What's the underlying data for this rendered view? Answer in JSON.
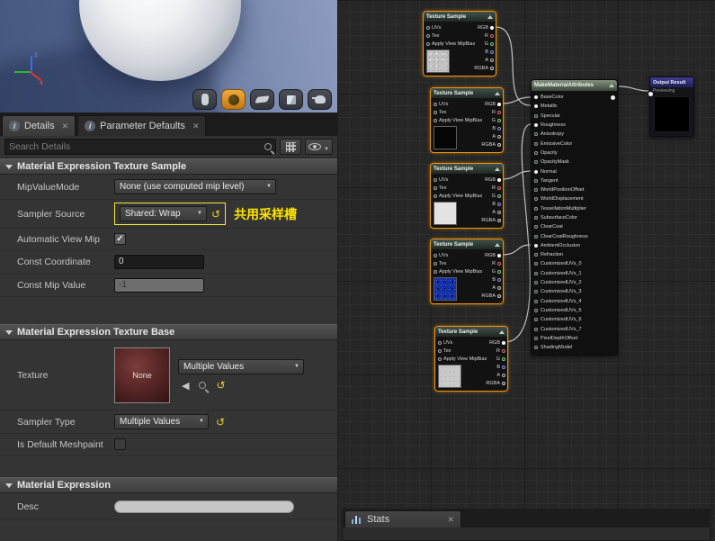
{
  "viewport": {
    "toolbar": [
      {
        "name": "preview-shape-cylinder",
        "selected": false
      },
      {
        "name": "preview-shape-sphere",
        "selected": true
      },
      {
        "name": "preview-shape-plane",
        "selected": false
      },
      {
        "name": "preview-shape-cube",
        "selected": false
      },
      {
        "name": "preview-shape-custom",
        "selected": false
      }
    ],
    "axis_labels": {
      "z": "z",
      "x": "x"
    }
  },
  "tabs": {
    "details": "Details",
    "parameter_defaults": "Parameter Defaults"
  },
  "search": {
    "placeholder": "Search Details"
  },
  "sections": {
    "texture_sample": {
      "title": "Material Expression Texture Sample",
      "mip_value_mode_label": "MipValueMode",
      "mip_value_mode_value": "None (use computed mip level)",
      "sampler_source_label": "Sampler Source",
      "sampler_source_value": "Shared: Wrap",
      "sampler_source_annotation": "共用采样槽",
      "automatic_view_mip_label": "Automatic View Mip",
      "automatic_view_mip_checked": true,
      "const_coordinate_label": "Const Coordinate",
      "const_coordinate_value": "0",
      "const_mip_value_label": "Const Mip Value",
      "const_mip_value_value": "-1"
    },
    "texture_base": {
      "title": "Material Expression Texture Base",
      "texture_label": "Texture",
      "texture_thumb_label": "None",
      "texture_value": "Multiple Values",
      "sampler_type_label": "Sampler Type",
      "sampler_type_value": "Multiple Values",
      "is_default_meshpaint_label": "Is Default Meshpaint",
      "is_default_meshpaint_checked": false
    },
    "material_expression": {
      "title": "Material Expression",
      "desc_label": "Desc",
      "desc_value": ""
    }
  },
  "graph": {
    "texture_node": {
      "title": "Texture Sample",
      "inputs": [
        "UVs",
        "Tex",
        "Apply View MipBias"
      ],
      "outputs": [
        {
          "label": "RGB",
          "color": "#ffffff",
          "connected": true
        },
        {
          "label": "R",
          "color": "#d96a6a",
          "connected": false
        },
        {
          "label": "G",
          "color": "#7ec97e",
          "connected": false
        },
        {
          "label": "B",
          "color": "#8a8adf",
          "connected": false
        },
        {
          "label": "A",
          "color": "#b8b8b8",
          "connected": false
        },
        {
          "label": "RGBA",
          "color": "#cccccc",
          "connected": false
        }
      ]
    },
    "texture_nodes": [
      {
        "thumb": "noise-light"
      },
      {
        "thumb": "black"
      },
      {
        "thumb": "white"
      },
      {
        "thumb": "noise-blue"
      },
      {
        "thumb": "gray"
      }
    ],
    "mma": {
      "title": "MakeMaterialAttributes",
      "pins": [
        "BaseColor",
        "Metallic",
        "Specular",
        "Roughness",
        "Anisotropy",
        "EmissiveColor",
        "Opacity",
        "OpacityMask",
        "Normal",
        "Tangent",
        "WorldPositionOffset",
        "WorldDisplacement",
        "TessellationMultiplier",
        "SubsurfaceColor",
        "ClearCoat",
        "ClearCoatRoughness",
        "AmbientOcclusion",
        "Refraction",
        "CustomizedUVs_0",
        "CustomizedUVs_1",
        "CustomizedUVs_2",
        "CustomizedUVs_3",
        "CustomizedUVs_4",
        "CustomizedUVs_5",
        "CustomizedUVs_6",
        "CustomizedUVs_7",
        "PixelDepthOffset",
        "ShadingModel"
      ],
      "connected": [
        "BaseColor",
        "Metallic",
        "Roughness",
        "Normal",
        "AmbientOcclusion"
      ]
    },
    "output_result": {
      "title": "Output Result",
      "subtitle": "Previewing"
    }
  },
  "stats": {
    "label": "Stats"
  },
  "colors": {
    "selection_orange": "#ef9512",
    "annotation_yellow": "#ffe400"
  }
}
